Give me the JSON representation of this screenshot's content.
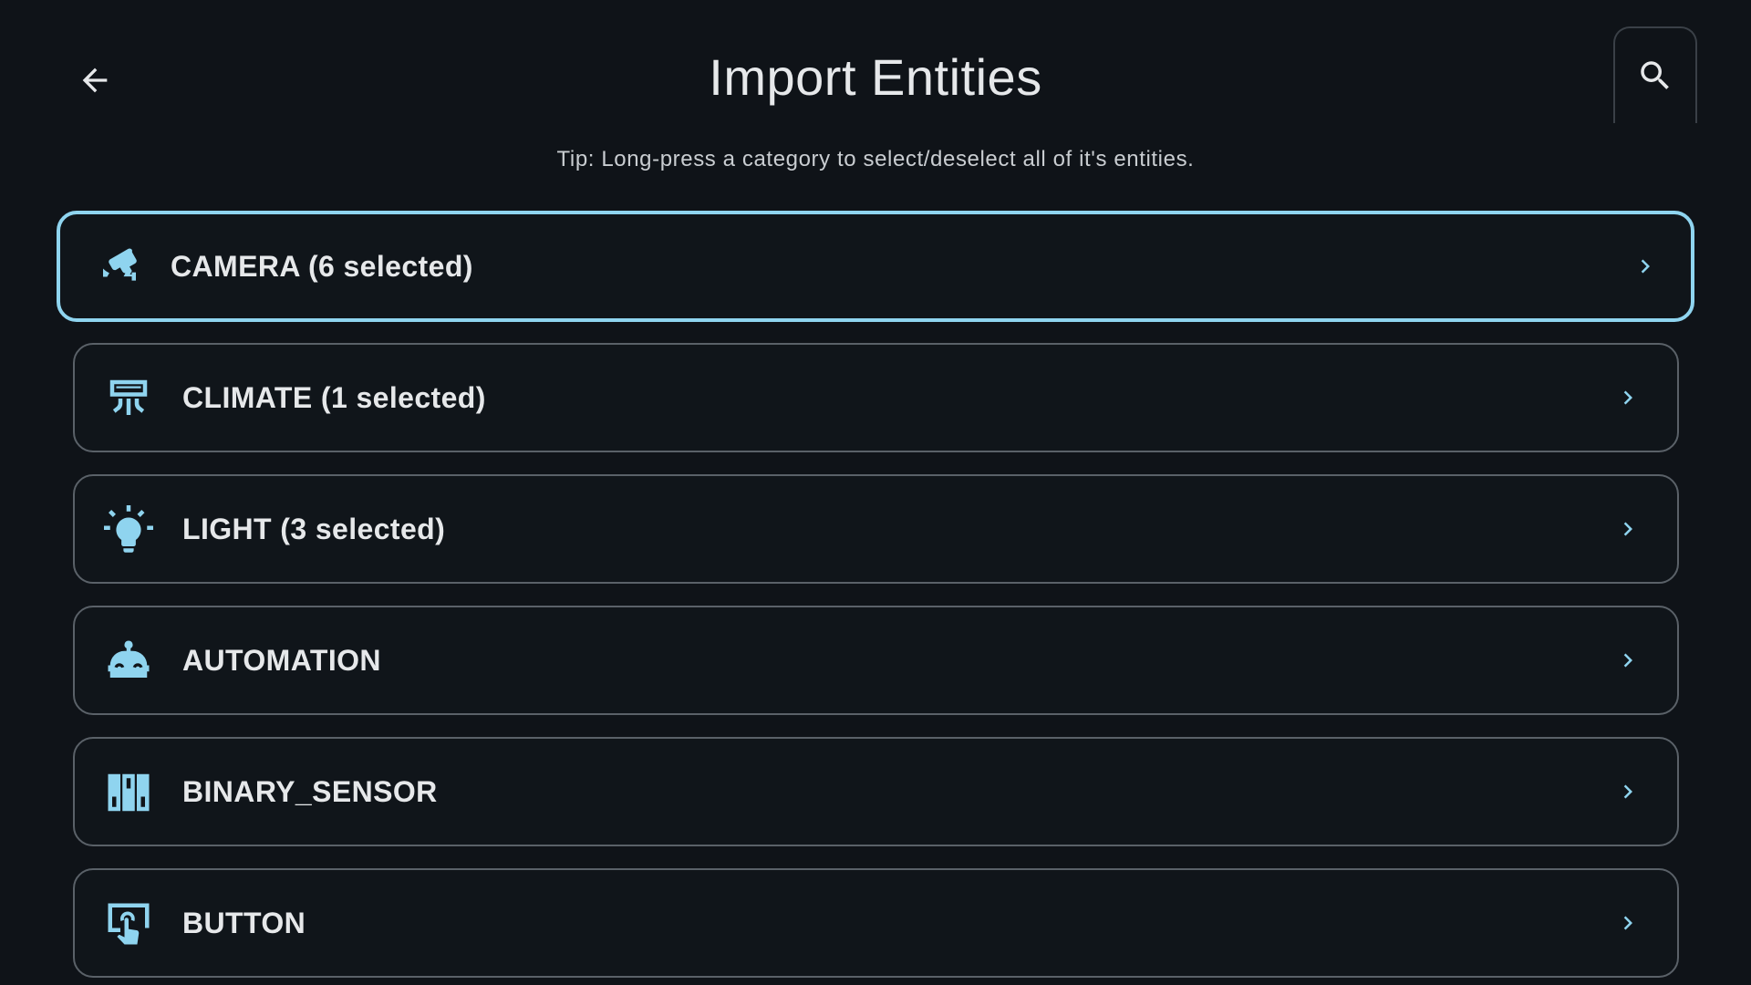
{
  "header": {
    "title": "Import Entities",
    "back_icon": "arrow-left-icon",
    "search_icon": "search-icon"
  },
  "tip": "Tip: Long-press a category to select/deselect all of it's entities.",
  "colors": {
    "background": "#0f1318",
    "accent": "#8fd4ef",
    "icon": "#8fd4ef",
    "border": "#5a6168",
    "text": "#e6e8ea"
  },
  "categories": [
    {
      "label": "CAMERA (6 selected)",
      "icon": "cctv-icon",
      "focused": true
    },
    {
      "label": "CLIMATE (1 selected)",
      "icon": "air-conditioner-icon",
      "focused": false
    },
    {
      "label": "LIGHT (3 selected)",
      "icon": "lightbulb-icon",
      "focused": false
    },
    {
      "label": "AUTOMATION",
      "icon": "robot-icon",
      "focused": false
    },
    {
      "label": "BINARY_SENSOR",
      "icon": "binary-sensor-icon",
      "focused": false
    },
    {
      "label": "BUTTON",
      "icon": "gesture-tap-button-icon",
      "focused": false
    }
  ]
}
